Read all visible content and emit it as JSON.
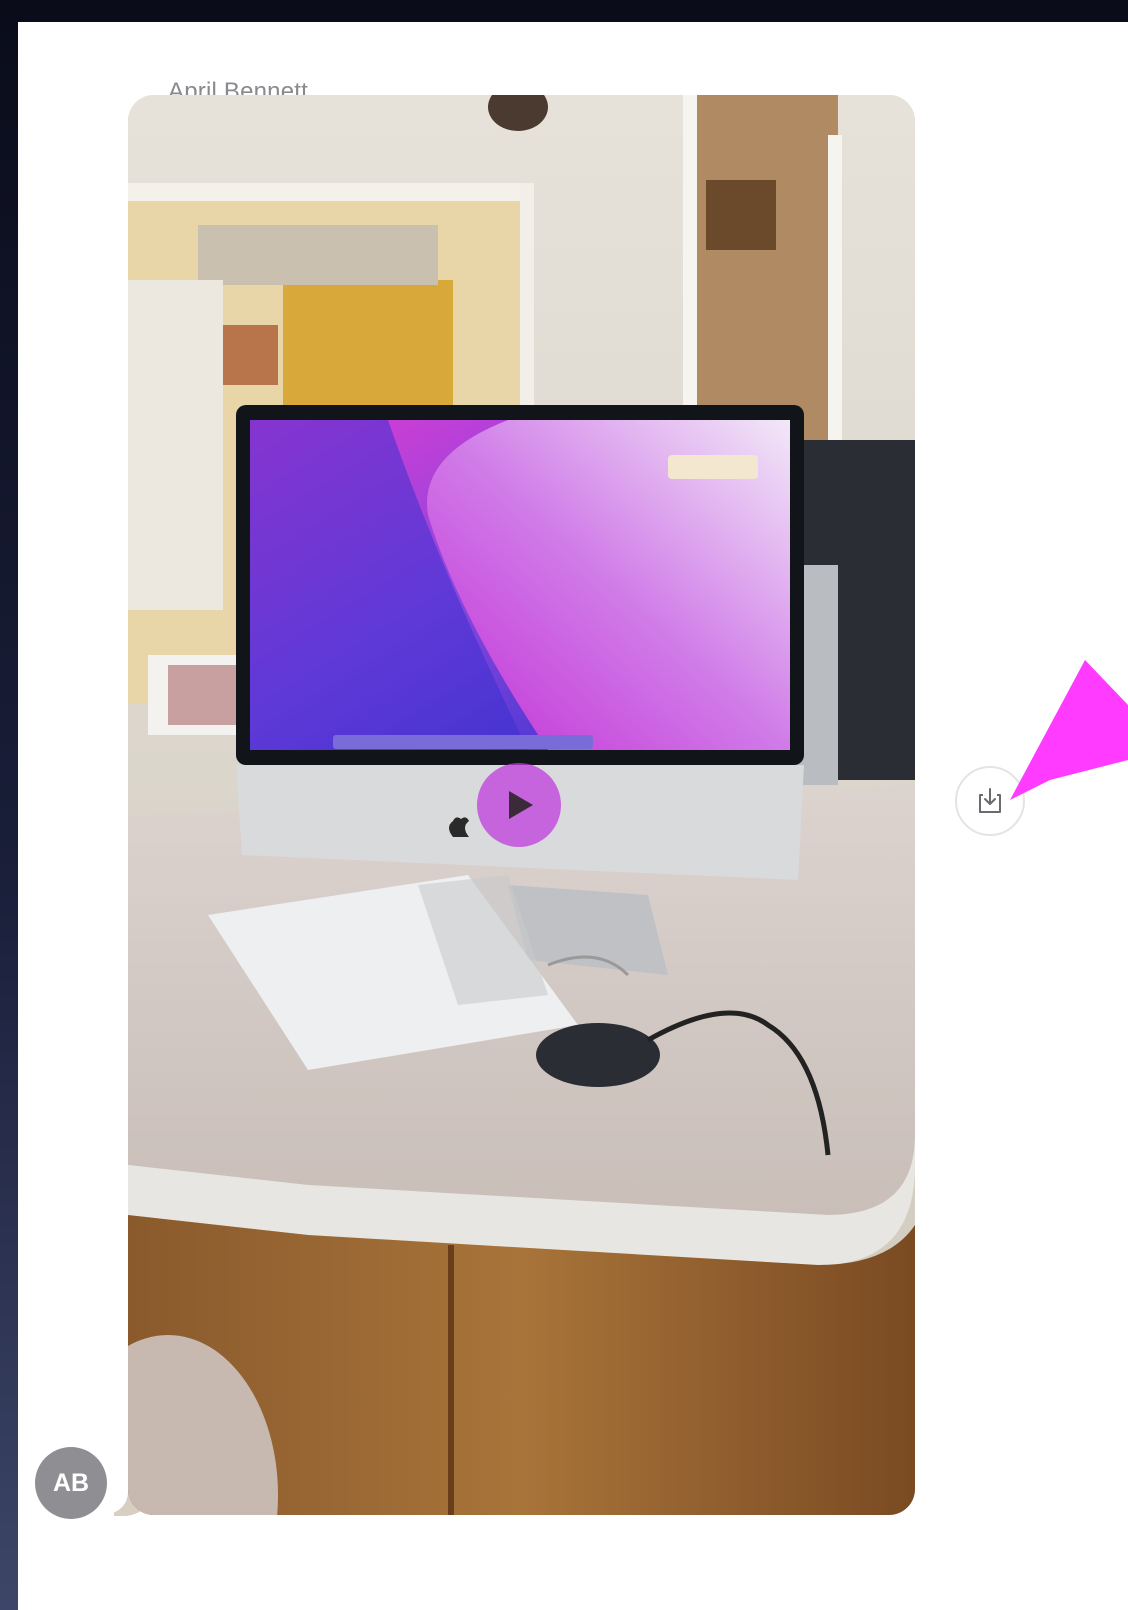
{
  "conversation": {
    "sender_name": "April Bennett",
    "avatar_initials": "AB"
  },
  "message": {
    "attachment_type": "video",
    "play_icon": "play-icon",
    "save_icon": "save-download-icon"
  },
  "annotation": {
    "arrow_color": "#ff3bff"
  },
  "colors": {
    "avatar_bg": "#8e8e93",
    "sender_text": "#8a8a8e",
    "play_button_bg": "#be3cdc"
  }
}
